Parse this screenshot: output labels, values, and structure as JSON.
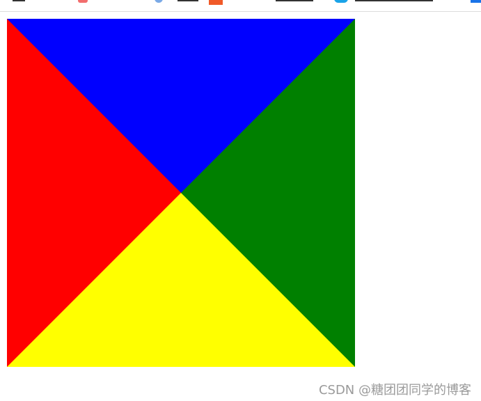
{
  "bookmarks_bar": {
    "visible_items": [
      {
        "icon": "bookmark-red-icon",
        "color": "#f26d6d"
      },
      {
        "icon": "bookmark-person-icon",
        "color": "#7aa9e6"
      },
      {
        "icon": "bookmark-orange-icon",
        "color": "#f05a28"
      },
      {
        "icon": "bookmark-cyan-icon",
        "color": "#1aa3e8"
      },
      {
        "icon": "bookmark-blue-icon",
        "color": "#1a73e8"
      }
    ]
  },
  "triangles": {
    "top": "#0000ff",
    "right": "#008000",
    "bottom": "#ffff00",
    "left": "#ff0000"
  },
  "watermark": {
    "text": "CSDN @糖团团同学的博客"
  }
}
